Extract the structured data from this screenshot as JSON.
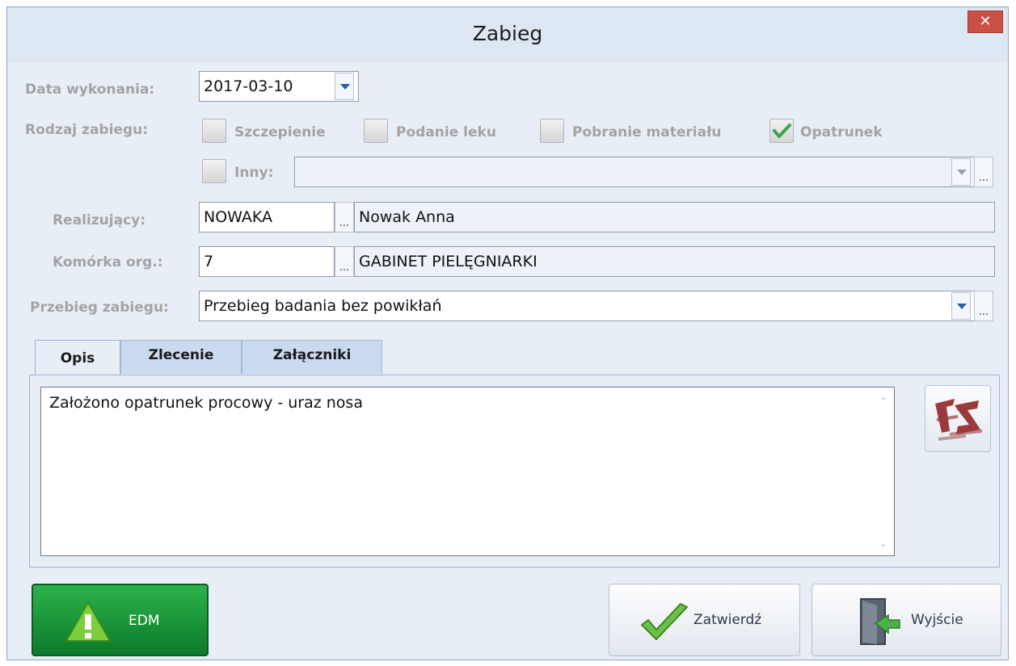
{
  "window": {
    "title": "Zabieg",
    "close_label": "✕"
  },
  "form": {
    "date": {
      "label": "Data wykonania:",
      "value": "2017-03-10"
    },
    "type": {
      "label": "Rodzaj zabiegu:",
      "options": [
        {
          "label": "Szczepienie",
          "checked": false
        },
        {
          "label": "Podanie leku",
          "checked": false
        },
        {
          "label": "Pobranie materiału",
          "checked": false
        },
        {
          "label": "Opatrunek",
          "checked": true
        }
      ],
      "other": {
        "label": "Inny:",
        "checked": false,
        "value": "",
        "dots": "..."
      }
    },
    "performer": {
      "label": "Realizujący:",
      "code": "NOWAKA",
      "name": "Nowak Anna",
      "dots": "..."
    },
    "unit": {
      "label": "Komórka org.:",
      "code": "7",
      "name": "GABINET PIELĘGNIARKI",
      "dots": "..."
    },
    "course": {
      "label": "Przebieg zabiegu:",
      "value": "Przebieg badania bez powikłań",
      "dots": "..."
    }
  },
  "tabs": [
    {
      "label": "Opis",
      "active": true
    },
    {
      "label": "Zlecenie",
      "active": false
    },
    {
      "label": "Załączniki",
      "active": false
    }
  ],
  "description": {
    "text": "Założono opatrunek procowy - uraz nosa"
  },
  "buttons": {
    "edm": "EDM",
    "confirm": "Zatwierdź",
    "exit": "Wyjście"
  },
  "colors": {
    "accent": "#1e5fa8",
    "edm_green": "#17913a",
    "close_red": "#c85044",
    "check_green": "#3aa64a"
  },
  "icons": {
    "az": "text-template-icon",
    "check": "checkmark-icon",
    "warning": "warning-icon",
    "exit": "door-exit-icon"
  }
}
